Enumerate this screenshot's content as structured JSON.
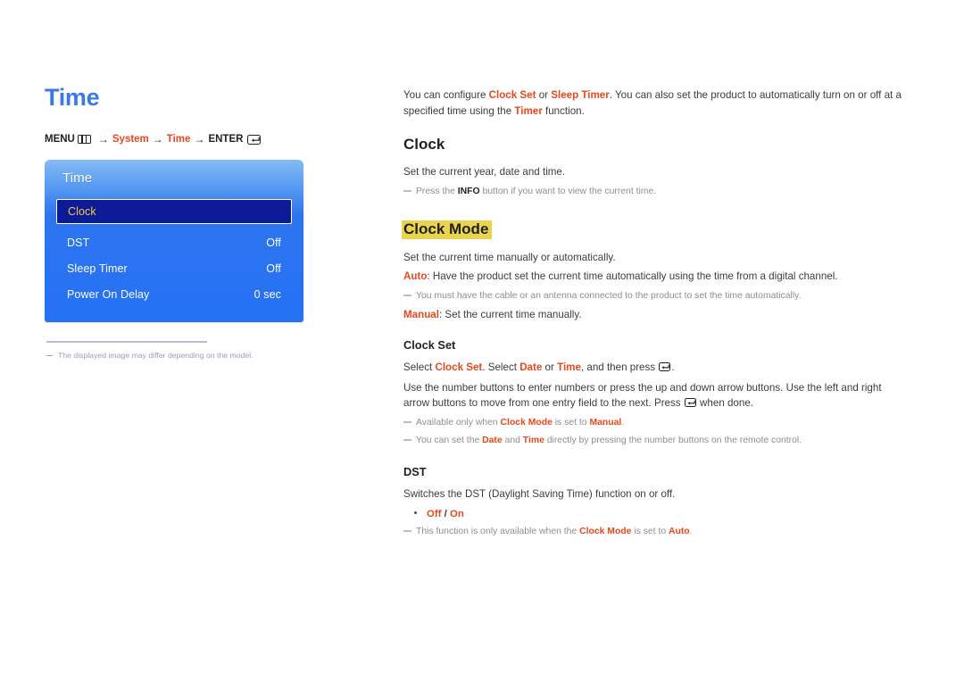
{
  "page": {
    "title": "Time"
  },
  "breadcrumb": {
    "menu_label": "MENU",
    "menu_icon": "menu-grid-icon",
    "arrow": "→",
    "step1": "System",
    "step2": "Time",
    "enter_label": "ENTER",
    "enter_icon": "enter-return-icon"
  },
  "osd": {
    "title": "Time",
    "rows": [
      {
        "label": "Clock",
        "value": "",
        "selected": true
      },
      {
        "label": "DST",
        "value": "Off",
        "selected": false
      },
      {
        "label": "Sleep Timer",
        "value": "Off",
        "selected": false
      },
      {
        "label": "Power On Delay",
        "value": "0 sec",
        "selected": false
      }
    ]
  },
  "left_note": {
    "text": "The displayed image may differ depending on the model."
  },
  "intro": {
    "p1_a": "You can configure ",
    "p1_b": "Clock Set",
    "p1_c": " or ",
    "p1_d": "Sleep Timer",
    "p1_e": ". You can also set the product to automatically turn on or off at a specified time using the ",
    "p1_f": "Timer",
    "p1_g": " function."
  },
  "clock": {
    "heading": "Clock",
    "desc": "Set the current year, date and time.",
    "note_a": "Press the ",
    "note_b": "INFO",
    "note_c": " button if you want to view the current time."
  },
  "clock_mode": {
    "heading": "Clock Mode",
    "highlighted": true,
    "highlight_color": "#e8d44d",
    "desc": "Set the current time manually or automatically.",
    "auto_label": "Auto",
    "auto_text": ": Have the product set the current time automatically using the time from a digital channel.",
    "auto_note": "You must have the cable or an antenna connected to the product to set the time automatically.",
    "manual_label": "Manual",
    "manual_text": ": Set the current time manually."
  },
  "clock_set": {
    "heading": "Clock Set",
    "l1_a": "Select ",
    "l1_b": "Clock Set",
    "l1_c": ". Select ",
    "l1_d": "Date",
    "l1_e": " or ",
    "l1_f": "Time",
    "l1_g": ", and then press ",
    "l1_h": ".",
    "l2_a": "Use the number buttons to enter numbers or press the up and down arrow buttons. Use the left and right arrow buttons to move from one entry field to the next. Press ",
    "l2_b": " when done.",
    "note1_a": "Available only when ",
    "note1_b": "Clock Mode",
    "note1_c": " is set to ",
    "note1_d": "Manual",
    "note1_e": ".",
    "note2_a": "You can set the ",
    "note2_b": "Date",
    "note2_c": " and ",
    "note2_d": "Time",
    "note2_e": " directly by pressing the number buttons on the remote control."
  },
  "dst": {
    "heading": "DST",
    "desc": "Switches the DST (Daylight Saving Time) function on or off.",
    "option_off": "Off",
    "option_sep": " / ",
    "option_on": "On",
    "note_a": "This function is only available when the ",
    "note_b": "Clock Mode",
    "note_c": " is set to ",
    "note_d": "Auto",
    "note_e": "."
  },
  "colors": {
    "title_blue": "#3b7ae4",
    "accent_red": "#e8481c",
    "osd_blue": "#2572f5",
    "osd_selected": "#0d1a96",
    "osd_selected_text": "#f5c842",
    "highlight_yellow": "#e8d44d",
    "note_gray": "#8e8e8e"
  }
}
